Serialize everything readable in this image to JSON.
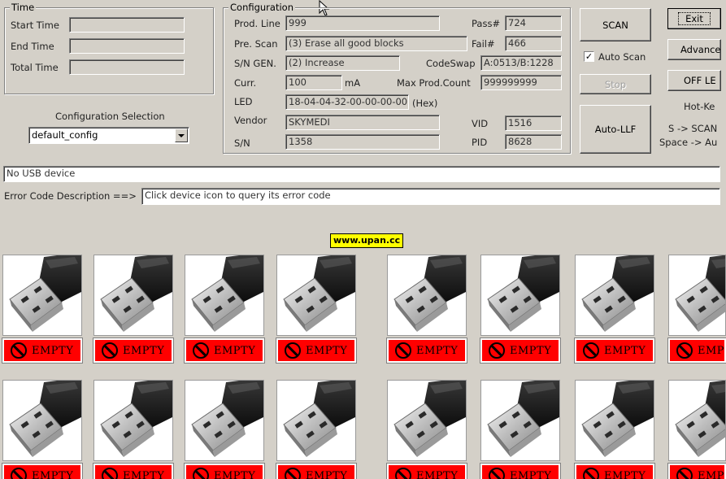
{
  "time_group": {
    "title": "Time",
    "start_label": "Start Time",
    "end_label": "End Time",
    "total_label": "Total Time",
    "start_value": "",
    "end_value": "",
    "total_value": ""
  },
  "config_selection": {
    "label": "Configuration Selection",
    "selected": "default_config"
  },
  "configuration": {
    "title": "Configuration",
    "prod_line_label": "Prod. Line",
    "prod_line_value": "999",
    "pre_scan_label": "Pre. Scan",
    "pre_scan_value": "(3) Erase all good blocks",
    "sn_gen_label": "S/N GEN.",
    "sn_gen_value": "(2) Increase",
    "curr_label": "Curr.",
    "curr_value": "100",
    "curr_unit": "mA",
    "led_label": "LED",
    "led_value": "18-04-04-32-00-00-00-00",
    "led_unit": "(Hex)",
    "vendor_label": "Vendor",
    "vendor_value": "SKYMEDI",
    "sn_label": "S/N",
    "sn_value": "1358",
    "pass_label": "Pass#",
    "pass_value": "724",
    "fail_label": "Fail#",
    "fail_value": "466",
    "codeswap_label": "CodeSwap",
    "codeswap_value": "A:0513/B:1228",
    "max_prod_label": "Max Prod.Count",
    "max_prod_value": "999999999",
    "vid_label": "VID",
    "vid_value": "1516",
    "pid_label": "PID",
    "pid_value": "8628"
  },
  "buttons": {
    "scan": "SCAN",
    "auto_scan": "Auto Scan",
    "auto_scan_checked": "✓",
    "stop": "Stop",
    "auto_llf": "Auto-LLF",
    "exit": "Exit",
    "advance": "Advance",
    "off_le": "OFF LE"
  },
  "hotkeys": {
    "title": "Hot-Ke",
    "line1": "S -> SCAN",
    "line2": "Space -> Au"
  },
  "status": {
    "usb_message": "No USB device",
    "error_code_label": "Error Code Description ==>",
    "error_code_value": "Click device icon to query its error code"
  },
  "watermark": "www.upan.cc",
  "devices": {
    "status_text": "EMPTY",
    "status_color": "#ff0000",
    "count_visible": 16
  }
}
